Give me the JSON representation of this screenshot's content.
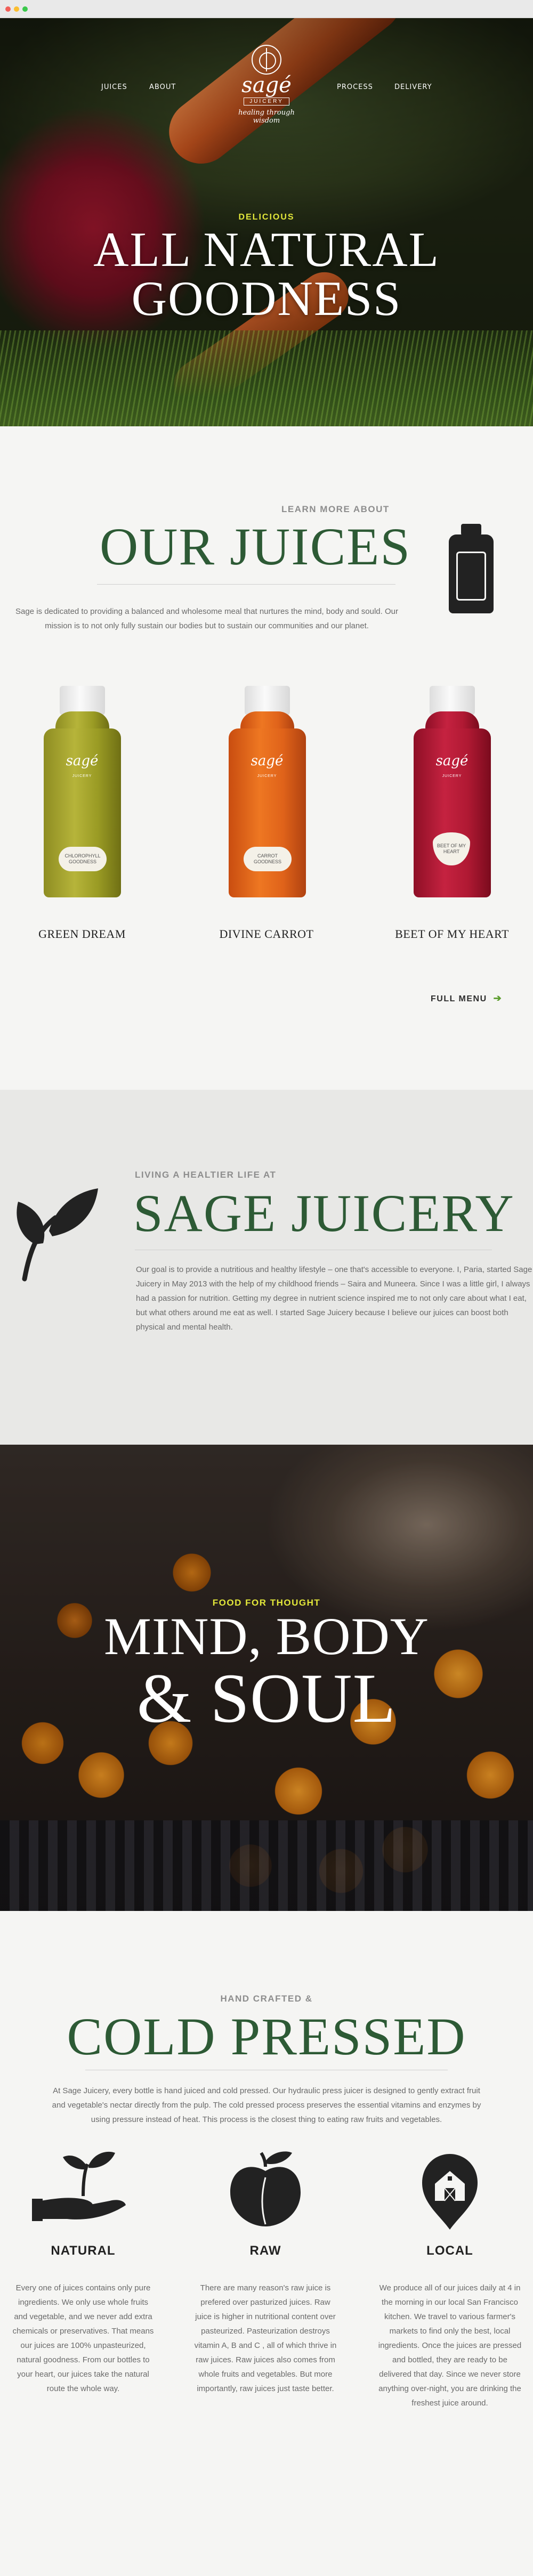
{
  "nav": {
    "items_left": [
      "JUICES",
      "ABOUT"
    ],
    "items_right": [
      "PROCESS",
      "DELIVERY"
    ]
  },
  "logo": {
    "name": "sagé",
    "sub": "JUICERY",
    "tagline": "healing through wisdom"
  },
  "hero": {
    "kicker": "DELICIOUS",
    "title_line1": "ALL NATURAL",
    "title_line2": "GOODNESS"
  },
  "juices": {
    "kicker": "LEARN MORE ABOUT",
    "title": "OUR JUICES",
    "description": "Sage is dedicated to providing a balanced and wholesome meal that nurtures the mind, body and sould. Our mission is to not only fully sustain our bodies but to sustain our communities and our planet.",
    "bottles": [
      {
        "name": "GREEN DREAM",
        "label": "sagé",
        "sub": "JUICERY",
        "tag": "CHLOROPHYLL GOODNESS"
      },
      {
        "name": "DIVINE CARROT",
        "label": "sagé",
        "sub": "JUICERY",
        "tag": "CARROT GOODNESS"
      },
      {
        "name": "BEET OF MY HEART",
        "label": "sagé",
        "sub": "JUICERY",
        "tag": "BEET OF MY HEART"
      }
    ],
    "full_menu": "FULL MENU",
    "arrow": "➔"
  },
  "sage": {
    "kicker": "LIVING A HEALTIER LIFE AT",
    "title": "SAGE JUICERY",
    "body": "Our goal is to provide a nutritious and healthy lifestyle – one that's accessible to everyone. I, Paria, started Sage Juicery in May 2013 with the help of my childhood friends – Saira and Muneera. Since I was a little girl, I always had a passion for nutrition. Getting my degree in nutrient science inspired me to not only care about what I eat, but what others around me eat as well. I started Sage Juicery because I believe our juices can boost both physical and mental health."
  },
  "mbs": {
    "kicker": "FOOD FOR THOUGHT",
    "title_line1": "MIND, BODY",
    "title_line2": "& SOUL"
  },
  "cold": {
    "kicker": "HAND CRAFTED &",
    "title": "COLD PRESSED",
    "body": "At Sage Juicery, every bottle is hand juiced and cold pressed. Our hydraulic press juicer is designed to gently extract fruit and vegetable's nectar directly from the pulp. The cold pressed process preserves the essential vitamins and enzymes by using pressure instead of heat. This process is the closest thing to eating raw fruits and vegetables.",
    "columns": [
      {
        "title": "NATURAL",
        "icon": "sprout-hand-icon",
        "text": "Every one of juices contains only pure ingredients. We only use whole fruits and vegetable, and we never add extra chemicals or preservatives. That means our juices are 100% unpasteurized, natural goodness. From our bottles to your heart, our juices take the natural route the whole way."
      },
      {
        "title": "RAW",
        "icon": "peach-icon",
        "text": "There are many reason's raw juice is prefered over pasturized juices. Raw juice is higher in nutritional content over pasteurized. Pasteurization destroys vitamin A, B and C , all of which thrive in raw juices. Raw juices also comes from whole fruits and vegetables. But more importantly, raw juices just taste better."
      },
      {
        "title": "LOCAL",
        "icon": "barn-pin-icon",
        "text": "We produce all of our juices daily at 4 in the morning in our local San Francisco kitchen. We travel to various farmer's markets to find only the best, local ingredients. Once the juices are pressed and bottled, they are ready to be delivered that day. Since we never store anything over-night, you are drinking the freshest juice around."
      }
    ]
  },
  "colors": {
    "green": "#2d5a35",
    "accent_yellow": "#e3e83a",
    "arrow_green": "#5c9d2e"
  }
}
